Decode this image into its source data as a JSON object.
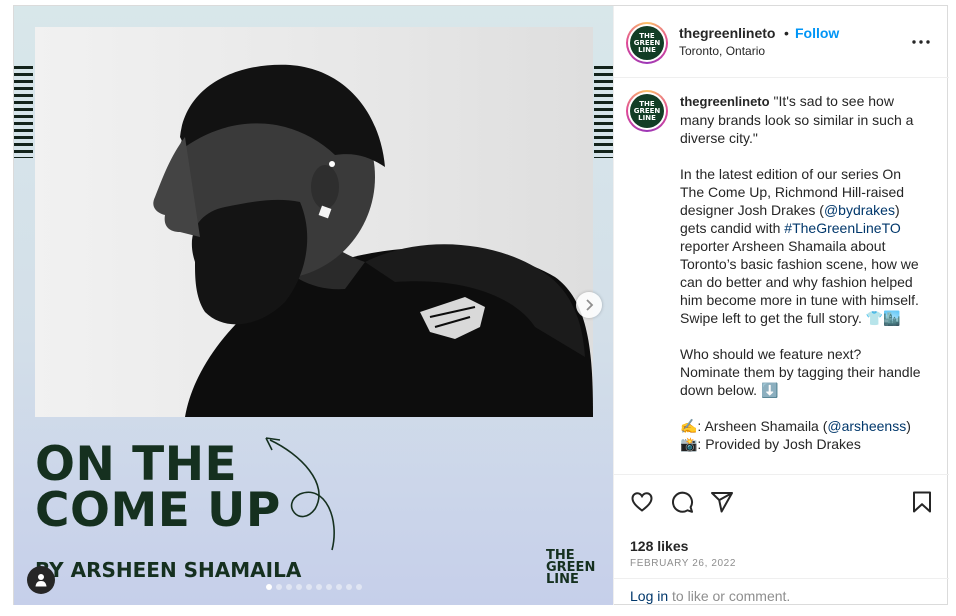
{
  "colors": {
    "follow_blue": "#0095f6",
    "link_blue": "#00376b",
    "brand_green": "#15301f",
    "muted_gray": "#8e8e8e",
    "divider": "#efefef"
  },
  "media": {
    "headline_line1": "ON THE",
    "headline_line2": "COME UP",
    "byline": "BY ARSHEEN SHAMAILA",
    "brand_logo": [
      "THE",
      "GREEN",
      "LINE"
    ],
    "carousel_total": 10,
    "carousel_active_index": 0,
    "icons": {
      "next": "chevron-right-icon",
      "user_tag": "person-icon"
    }
  },
  "header": {
    "username": "thegreenlineto",
    "separator": "•",
    "follow_label": "Follow",
    "location": "Toronto, Ontario",
    "avatar_text": [
      "THE",
      "GREEN",
      "LINE"
    ],
    "more_icon": "more-options-icon"
  },
  "caption": {
    "username": "thegreenlineto",
    "p1": "\"It's sad to see how many brands look so similar in such a diverse city.\"",
    "p2_a": "In the latest edition of our series On The Come Up, Richmond Hill-raised designer Josh Drakes (",
    "p2_mention": "@bydrakes",
    "p2_b": ") gets candid with ",
    "p2_hashtag": "#TheGreenLineTO",
    "p2_c": " reporter Arsheen Shamaila about Toronto’s basic fashion scene, how we can do better and why fashion helped him become more in tune with himself. Swipe left to get the full story. 👕🏙️",
    "p3": "Who should we feature next? Nominate them by tagging their handle down below. ⬇️",
    "credit1_a": "✍️: Arsheen Shamaila (",
    "credit1_mention": "@arsheenss",
    "credit1_b": ")",
    "credit2": "📸: Provided by Josh Drakes"
  },
  "actions": {
    "icons": [
      "heart-icon",
      "comment-icon",
      "share-icon",
      "bookmark-icon"
    ],
    "likes": "128 likes",
    "date": "FEBRUARY 26, 2022",
    "login_link": "Log in",
    "login_rest": " to like or comment."
  }
}
